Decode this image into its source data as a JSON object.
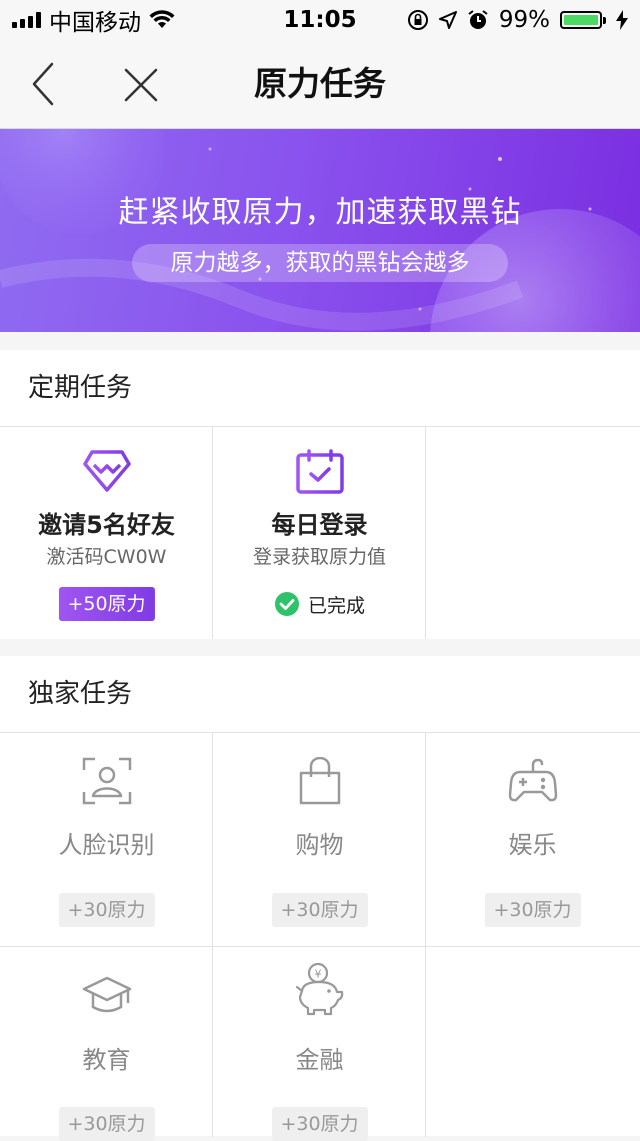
{
  "status_bar": {
    "carrier": "中国移动",
    "time": "11:05",
    "battery_percent": "99%",
    "battery_level": 0.99,
    "battery_color": "#4cd964",
    "icons": [
      "signal-icon",
      "wifi-icon",
      "rotation-lock-icon",
      "location-icon",
      "alarm-icon",
      "battery-icon",
      "charging-icon"
    ]
  },
  "nav": {
    "title": "原力任务",
    "back_icon": "chevron-left-icon",
    "close_icon": "close-icon"
  },
  "banner": {
    "title": "赶紧收取原力，加速获取黑钻",
    "subtitle": "原力越多，获取的黑钻会越多",
    "gradient": [
      "#8f6cf0",
      "#7a2ee0"
    ]
  },
  "periodic": {
    "header": "定期任务",
    "tasks": [
      {
        "icon": "diamond-icon",
        "title": "邀请5名好友",
        "subtitle": "激活码CW0W",
        "reward": "+50原力"
      },
      {
        "icon": "calendar-check-icon",
        "title": "每日登录",
        "subtitle": "登录获取原力值",
        "status": "已完成"
      }
    ]
  },
  "exclusive": {
    "header": "独家任务",
    "tasks": [
      {
        "icon": "face-recognition-icon",
        "title": "人脸识别",
        "reward": "+30原力"
      },
      {
        "icon": "shopping-bag-icon",
        "title": "购物",
        "reward": "+30原力"
      },
      {
        "icon": "gamepad-icon",
        "title": "娱乐",
        "reward": "+30原力"
      },
      {
        "icon": "graduation-cap-icon",
        "title": "教育",
        "reward": "+30原力"
      },
      {
        "icon": "piggy-bank-icon",
        "title": "金融",
        "reward": "+30原力"
      }
    ]
  },
  "colors": {
    "accent": "#8a46ec",
    "done_green": "#2ec26a",
    "muted_icon": "#999999"
  }
}
